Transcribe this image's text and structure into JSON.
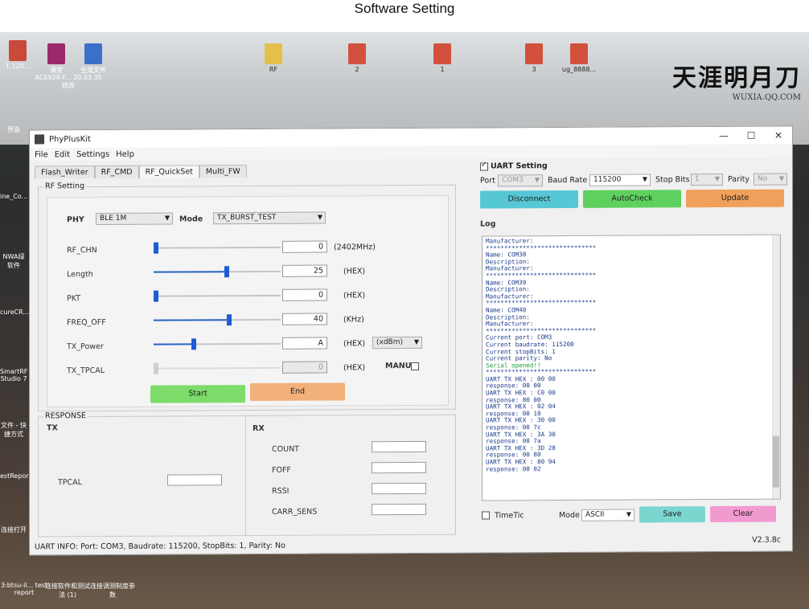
{
  "caption": "Software Setting",
  "desktop": {
    "brand_big": "天涯明月刀",
    "brand_small": "WUXIA.QQ.COM",
    "icons": [
      {
        "label": "1.120..."
      },
      {
        "label": "课堂"
      },
      {
        "label": "生成文件"
      },
      {
        "label": "AC692X-F... 20.03.30修改"
      },
      {
        "label": "RF"
      },
      {
        "label": "2"
      },
      {
        "label": "1"
      },
      {
        "label": "3"
      },
      {
        "label": "ug_8888..."
      }
    ],
    "left_labels": [
      "界面",
      "ine_Co...",
      "NWA绿软件",
      "cureCR...",
      "SmartRF Studio 7",
      "文件 - 快捷方式",
      "estRepor",
      "连接打开"
    ],
    "taskbar_items": [
      "3:btsu-il... test report",
      "连接软件和测试法 (1)",
      "连接调测制度参数"
    ]
  },
  "window": {
    "title": "PhyPlusKit",
    "menu": [
      "File",
      "Edit",
      "Settings",
      "Help"
    ],
    "controls": [
      "—",
      "☐",
      "✕"
    ],
    "tabs": [
      "Flash_Writer",
      "RF_CMD",
      "RF_QuickSet",
      "Multi_FW"
    ],
    "rf_setting_title": "RF Setting",
    "phy_label": "PHY",
    "phy_value": "BLE 1M",
    "mode_label": "Mode",
    "mode_value": "TX_BURST_TEST",
    "params": [
      {
        "name": "RF_CHN",
        "value": "0",
        "unit": "(2402MHz)",
        "level": 0.0
      },
      {
        "name": "Length",
        "value": "25",
        "unit": "(HEX)",
        "level": 0.58
      },
      {
        "name": "PKT",
        "value": "0",
        "unit": "(HEX)",
        "level": 0.0
      },
      {
        "name": "FREQ_OFF",
        "value": "40",
        "unit": "(KHz)",
        "level": 0.6
      },
      {
        "name": "TX_Power",
        "value": "A",
        "unit": "(HEX)",
        "level": 0.31
      },
      {
        "name": "TX_TPCAL",
        "value": "0",
        "unit": "(HEX)",
        "level": 0.0
      }
    ],
    "dbm_value": "(xdBm)",
    "manu_label": "MANU",
    "start_label": "Start",
    "end_label": "End",
    "response_title": "RESPONSE",
    "tx_label": "TX",
    "tpcal_label": "TPCAL",
    "rx_label": "RX",
    "rx_fields": [
      "COUNT",
      "FOFF",
      "RSSI",
      "CARR_SENS"
    ],
    "status": "UART INFO: Port: COM3, Baudrate: 115200, StopBits: 1, Parity: No",
    "version": "V2.3.8c"
  },
  "uart": {
    "title": "UART Setting",
    "port_label": "Port",
    "port_value": "COM3",
    "baud_label": "Baud Rate",
    "baud_value": "115200",
    "stop_label": "Stop Bits",
    "stop_value": "1",
    "parity_label": "Parity",
    "parity_value": "No",
    "disconnect_label": "Disconnect",
    "autocheck_label": "AutoCheck",
    "update_label": "Update",
    "log_title": "Log",
    "log_lines": [
      "Manufacturer:",
      "******************************",
      "Name: COM38",
      "Description:",
      "Manufacturer:",
      "******************************",
      "Name: COM39",
      "Description:",
      "Manufacturer:",
      "******************************",
      "Name: COM40",
      "Description:",
      "Manufacturer:",
      "******************************",
      "Current port: COM3",
      "Current baudrate: 115200",
      "Current stopBits: 1",
      "Current parity: No",
      "Serial opened!!",
      "******************************",
      "UART TX HEX : 00 00",
      "response: 00 00",
      "UART TX HEX : C0 00",
      "response: 80 00",
      "UART TX HEX : 02 04",
      "response: 00 10",
      "UART TX HEX : 30 00",
      "response: 00 7c",
      "UART TX HEX : 3A 30",
      "response: 00 7a",
      "UART TX HEX : 3D 28",
      "response: 00 80",
      "UART TX HEX : 80 94",
      "response: 00 02"
    ],
    "timetic_label": "TimeTic",
    "mode_label": "Mode",
    "mode_value": "ASCII",
    "save_label": "Save",
    "clear_label": "Clear"
  },
  "colors": {
    "disconnect": "#56c7d4",
    "autocheck": "#5ed05e",
    "update": "#f0a05a",
    "start": "#7ddc6a",
    "end": "#f2b07a",
    "save": "#7ad6cf",
    "clear": "#f19ad0"
  }
}
